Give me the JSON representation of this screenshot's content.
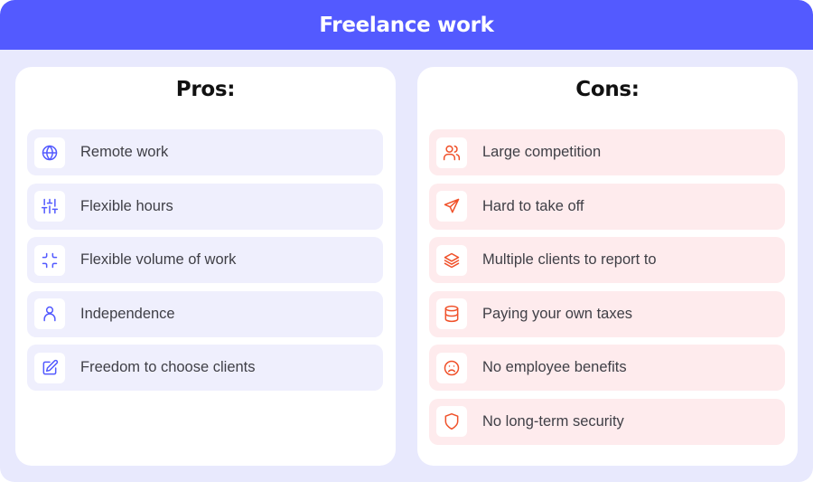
{
  "header": {
    "title": "Freelance work"
  },
  "colors": {
    "accent": "#535AFF",
    "background": "#E8E9FD",
    "pros_row_bg": "#EFEFFD",
    "cons_row_bg": "#FEEBED",
    "cons_icon": "#F0512A"
  },
  "pros": {
    "title": "Pros:",
    "items": [
      {
        "label": "Remote work",
        "icon": "globe-icon"
      },
      {
        "label": "Flexible hours",
        "icon": "sliders-icon"
      },
      {
        "label": "Flexible volume of work",
        "icon": "minimize-icon"
      },
      {
        "label": "Independence",
        "icon": "user-icon"
      },
      {
        "label": "Freedom to choose clients",
        "icon": "edit-icon"
      }
    ]
  },
  "cons": {
    "title": "Cons:",
    "items": [
      {
        "label": "Large competition",
        "icon": "users-icon"
      },
      {
        "label": "Hard to take off",
        "icon": "send-icon"
      },
      {
        "label": "Multiple clients to report to",
        "icon": "layers-icon"
      },
      {
        "label": "Paying your own taxes",
        "icon": "database-icon"
      },
      {
        "label": "No employee benefits",
        "icon": "frown-icon"
      },
      {
        "label": "No long-term security",
        "icon": "shield-icon"
      }
    ]
  }
}
